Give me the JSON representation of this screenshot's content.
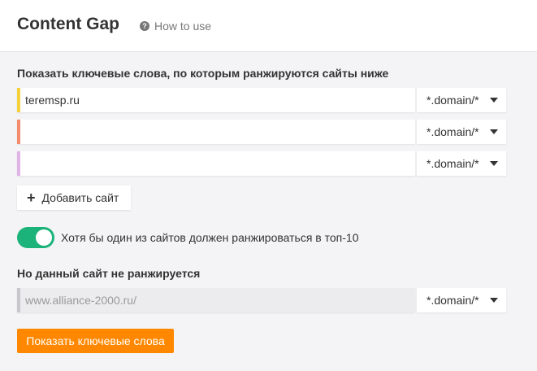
{
  "header": {
    "title": "Content Gap",
    "help_icon": "?",
    "how_to_use": "How to use"
  },
  "sites_section": {
    "label": "Показать ключевые слова, по которым ранжируются сайты ниже",
    "rows": [
      {
        "value": "teremsp.ru",
        "mode": "*.domain/*",
        "accent": "#f5d23c"
      },
      {
        "value": "",
        "mode": "*.domain/*",
        "accent": "#f28c6b"
      },
      {
        "value": "",
        "mode": "*.domain/*",
        "accent": "#e0b3e6"
      }
    ],
    "add_button": {
      "icon": "+",
      "label": "Добавить сайт"
    }
  },
  "toggle": {
    "state": "on",
    "color": "#1bb37a",
    "label": "Хотя бы один из сайтов должен ранжироваться в топ-10"
  },
  "exclude_section": {
    "label": "Но данный сайт не ранжируется",
    "placeholder": "www.alliance-2000.ru/",
    "mode": "*.domain/*",
    "accent": "#c8c8cc"
  },
  "submit": {
    "label": "Показать ключевые слова",
    "color": "#ff8800"
  }
}
